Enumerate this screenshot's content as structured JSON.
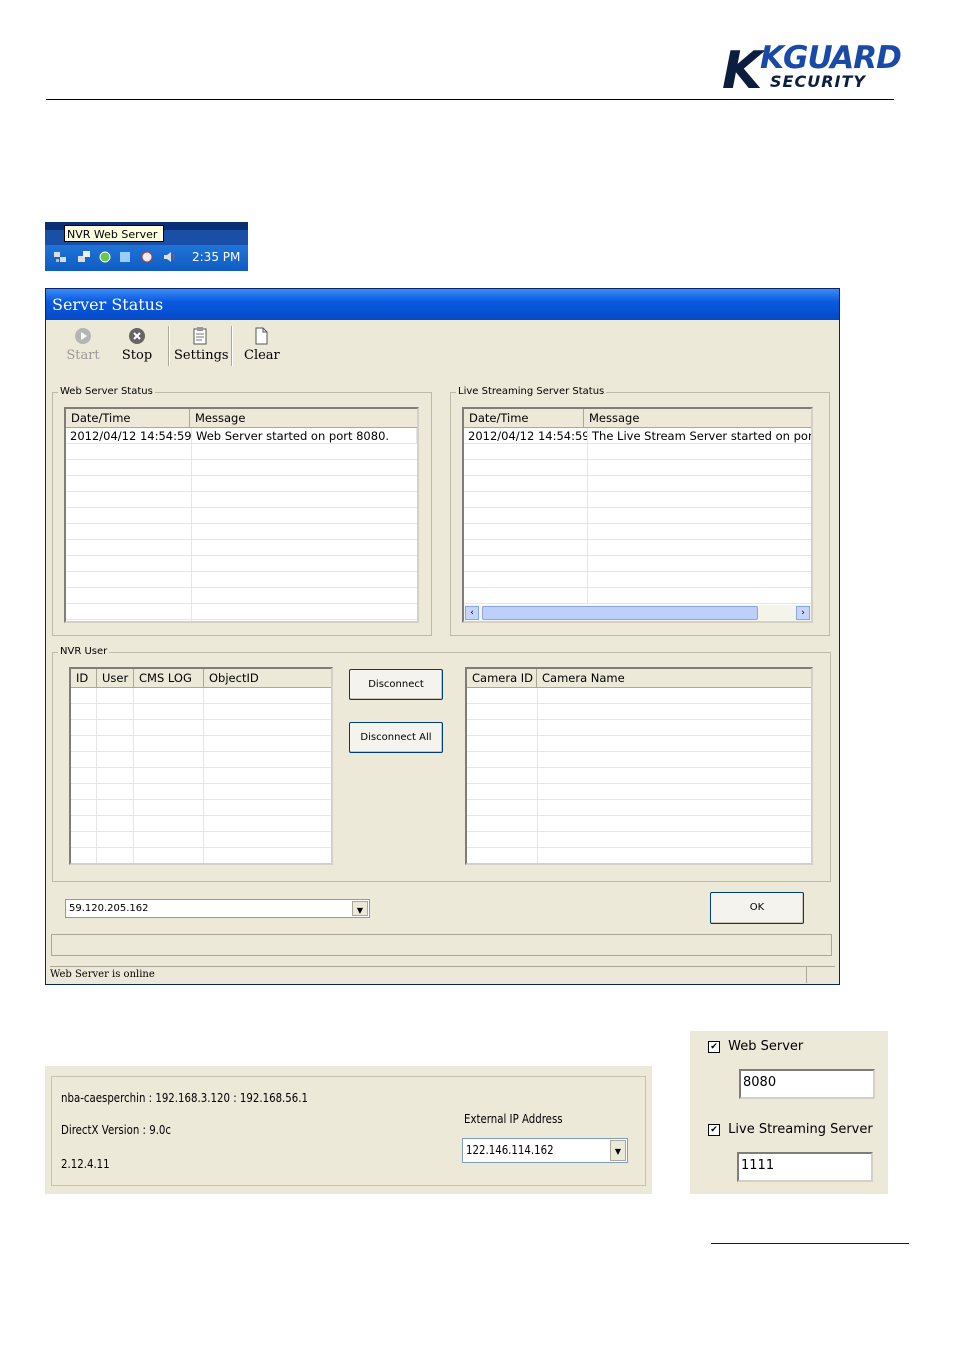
{
  "logo": {
    "line1": "KGUARD",
    "line2": "SECURITY"
  },
  "taskbar": {
    "tooltip": "NVR Web Server",
    "clock": "2:35 PM"
  },
  "window": {
    "title": "Server Status",
    "toolbar": {
      "start": "Start",
      "stop": "Stop",
      "settings": "Settings",
      "clear": "Clear"
    },
    "web_group": "Web Server Status",
    "live_group": "Live Streaming Server Status",
    "log_columns": [
      "Date/Time",
      "Message"
    ],
    "web_rows": [
      {
        "datetime": "2012/04/12 14:54:59",
        "message": "Web Server started on port 8080."
      }
    ],
    "live_rows": [
      {
        "datetime": "2012/04/12 14:54:59",
        "message": "The Live Stream Server started on port"
      }
    ],
    "user_group": "NVR User",
    "user_columns": [
      "ID",
      "User",
      "CMS LOG",
      "ObjectID"
    ],
    "camera_columns": [
      "Camera ID",
      "Camera Name"
    ],
    "disconnect": "Disconnect",
    "disconnect_all": "Disconnect All",
    "ip_combo": "59.120.205.162",
    "ok": "OK",
    "status_text": "Web Server is online"
  },
  "info_panel": {
    "host_line": "nba-caesperchin : 192.168.3.120 : 192.168.56.1",
    "directx": "DirectX Version : 9.0c",
    "version": "2.12.4.11",
    "external_label": "External IP Address",
    "external_ip": "122.146.114.162"
  },
  "port_panel": {
    "web_label": "Web Server",
    "web_port": "8080",
    "live_label": "Live Streaming Server",
    "live_port": "1111"
  },
  "colors": {
    "title_blue": "#0a5ae0",
    "face": "#ece9d8",
    "taskbar": "#1f74d8"
  }
}
